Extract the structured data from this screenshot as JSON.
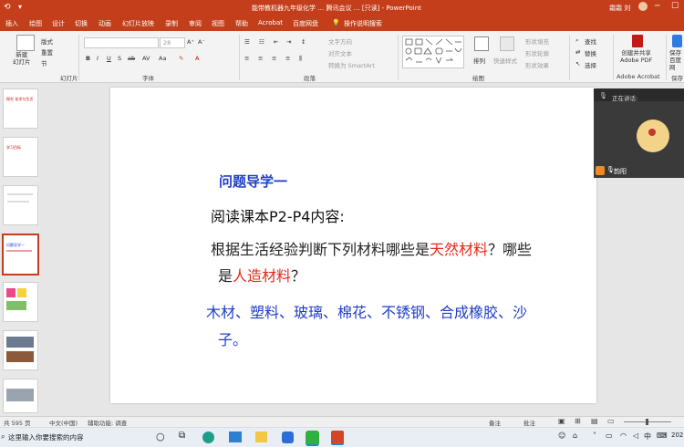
{
  "titlebar": {
    "title": "能带教机器九年级化学 … 腾讯会议 … [只读] - PowerPoint",
    "user": "霜霜 刘"
  },
  "tabs": [
    "插入",
    "绘图",
    "设计",
    "切换",
    "动画",
    "幻灯片放映",
    "录制",
    "审阅",
    "视图",
    "帮助",
    "Acrobat",
    "百度网盘",
    "操作说明搜索"
  ],
  "ribbon": {
    "new_slide": "新建\n幻灯片",
    "layout": "版式",
    "reset": "重置",
    "section": "节",
    "slides_group": "幻灯片",
    "font_size": "28",
    "font_group": "字体",
    "text_direction": "文字方向",
    "align_text": "对齐文本",
    "smartart": "转换为 SmartArt",
    "paragraph_group": "段落",
    "arrange": "排列",
    "quick_styles": "快速样式",
    "shape_fill": "形状填充",
    "shape_outline": "形状轮廓",
    "shape_effects": "形状效果",
    "drawing_group": "绘图",
    "find": "查找",
    "replace": "替换",
    "select": "选择",
    "create_pdf": "创建并共享\nAdobe PDF",
    "acrobat_group": "Adobe Acrobat",
    "save_baidu": "保存\n百度网",
    "save_group": "保存"
  },
  "video": {
    "speaking_label": "正在讲话:",
    "name": "韵阳"
  },
  "slide": {
    "title": "问题导学一",
    "line1": "阅读课本P2-P4内容:",
    "line2_prefix": "根据生活经验判断下列材料哪些是",
    "line2_natural": "天然材料",
    "line2_suffix": "？哪些",
    "line3_prefix": "是",
    "line3_artificial": "人造材料",
    "line3_suffix": "？",
    "materials_line1": "木材、塑料、玻璃、棉花、不锈钢、合成橡胶、沙",
    "materials_line2": "子。"
  },
  "thumbnails": [
    {
      "text": "探究 化学与生活"
    },
    {
      "text": "学习目标"
    },
    {
      "text": ""
    },
    {
      "text": "问题导学一"
    },
    {
      "text": ""
    },
    {
      "text": ""
    },
    {
      "text": ""
    }
  ],
  "status": {
    "slide_count": "共 595 页",
    "language": "中文(中国)",
    "accessibility": "辅助功能: 调查",
    "notes": "备注",
    "comments": "批注"
  },
  "taskbar": {
    "search_placeholder": "这里输入你要搜索的内容",
    "ime": "中",
    "year": "202"
  },
  "colors": {
    "brand": "#c43e1c",
    "title_blue": "#1f3ec8",
    "emph_red": "#e8271a",
    "materials_blue": "#1f3ec8"
  }
}
